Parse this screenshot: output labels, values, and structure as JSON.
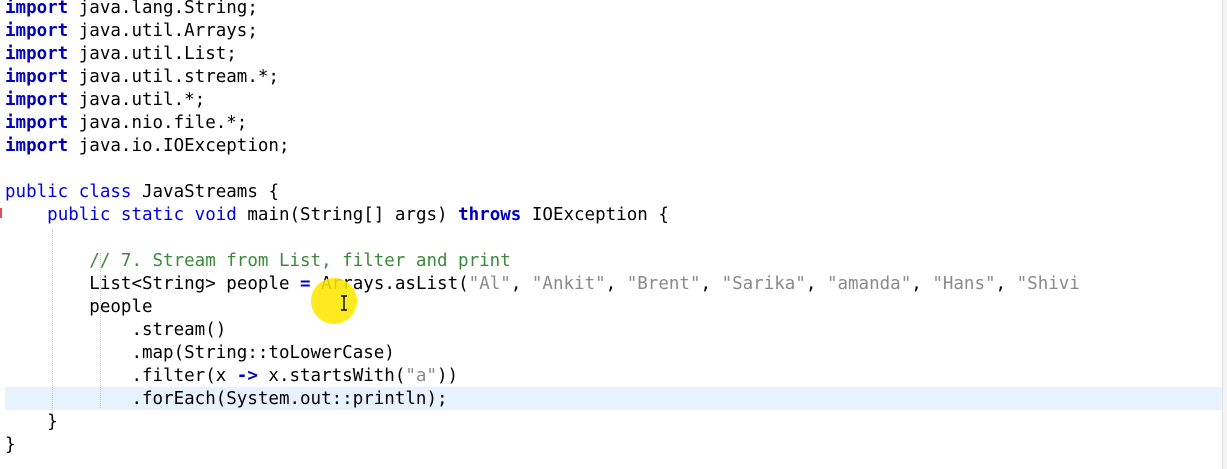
{
  "code": {
    "imports": [
      {
        "keyword": "import",
        "path": "java.lang.String;"
      },
      {
        "keyword": "import",
        "path": "java.util.Arrays;"
      },
      {
        "keyword": "import",
        "path": "java.util.List;"
      },
      {
        "keyword": "import",
        "path": "java.util.stream.*;"
      },
      {
        "keyword": "import",
        "path": "java.util.*;"
      },
      {
        "keyword": "import",
        "path": "java.nio.file.*;"
      },
      {
        "keyword": "import",
        "path": "java.io.IOException;"
      }
    ],
    "class_decl": {
      "modifiers": "public class",
      "name": "JavaStreams",
      "brace": "{"
    },
    "main_decl": {
      "modifiers": "public static void",
      "name": "main",
      "params": "(String[] args)",
      "throws_kw": "throws",
      "exception": "IOException",
      "brace": "{"
    },
    "comment": "// 7. Stream from List, filter and print",
    "list_decl": {
      "type": "List<String>",
      "var": "people",
      "eq": "=",
      "call": "Arrays.asList(",
      "strings": [
        "\"Al\"",
        "\"Ankit\"",
        "\"Brent\"",
        "\"Sarika\"",
        "\"amanda\"",
        "\"Hans\"",
        "\"Shivi"
      ],
      "separator": ", "
    },
    "chain": {
      "receiver": "people",
      "stream": ".stream()",
      "map": ".map(String::toLowerCase)",
      "filter_prefix": ".filter(x ",
      "arrow": "->",
      "filter_mid": " x.startsWith(",
      "filter_arg": "\"a\"",
      "filter_suffix": "))",
      "foreach": ".forEach(System.out::println);"
    },
    "close_method": "}",
    "close_class": "}"
  },
  "colors": {
    "keyword": "#0000c0",
    "comment": "#3a8a3a",
    "string": "#8a8a8a",
    "current_line": "#e8f2fe",
    "cursor_highlight": "#ffe600"
  },
  "icons": {
    "mouse_pointer": "ibeam-cursor-icon"
  }
}
